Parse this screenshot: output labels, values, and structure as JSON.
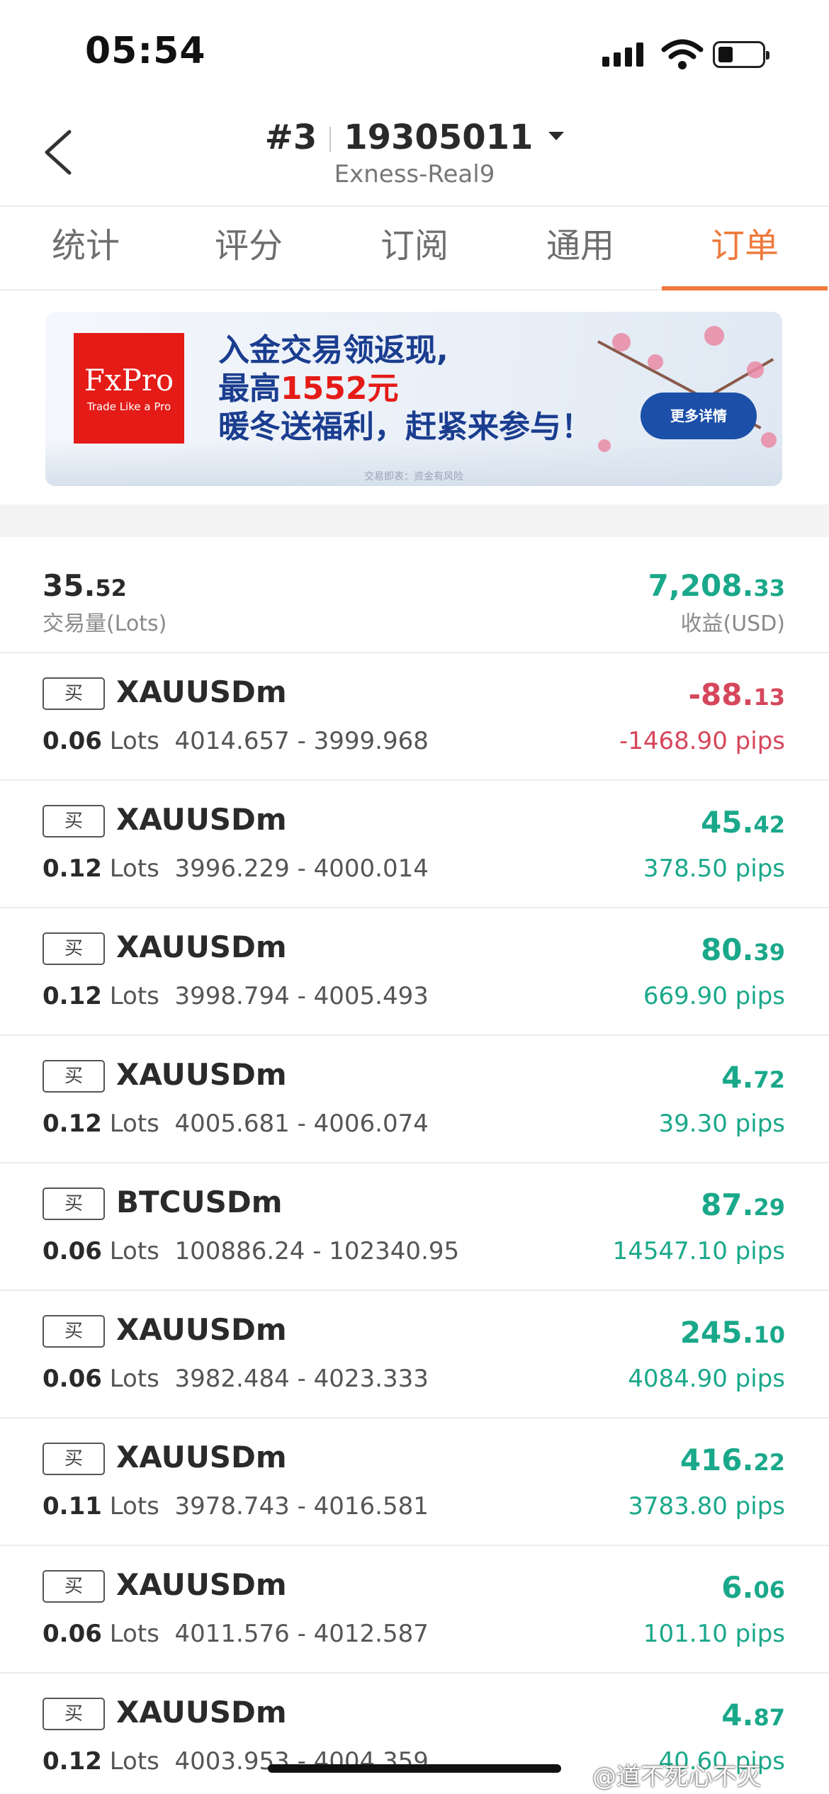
{
  "status_bar": {
    "time": "05:54"
  },
  "header": {
    "account_index": "#3",
    "account_number": "19305011",
    "server": "Exness-Real9"
  },
  "tabs": [
    {
      "label": "统计"
    },
    {
      "label": "评分"
    },
    {
      "label": "订阅"
    },
    {
      "label": "通用"
    },
    {
      "label": "订单",
      "active": true
    }
  ],
  "banner": {
    "logo_title": "FxPro",
    "logo_tagline": "Trade Like a Pro",
    "line1": "入金交易领返现,",
    "line2_prefix": "最高",
    "line2_highlight": "1552元",
    "line3": "暖冬送福利，赶紧来参与！",
    "button": "更多详情",
    "disclaimer": "交易即表：资金有风险"
  },
  "summary": {
    "volume_int": "35.",
    "volume_dec": "52",
    "volume_label": "交易量(Lots)",
    "profit_int": "7,208.",
    "profit_dec": "33",
    "profit_label": "收益(USD)"
  },
  "orders": [
    {
      "side": "买",
      "symbol": "XAUUSDm",
      "lots": "0.06",
      "lots_unit": "Lots",
      "prices": "4014.657 - 3999.968",
      "profit_int": "-88.",
      "profit_dec": "13",
      "pips": "-1468.90 pips",
      "positive": false
    },
    {
      "side": "买",
      "symbol": "XAUUSDm",
      "lots": "0.12",
      "lots_unit": "Lots",
      "prices": "3996.229 - 4000.014",
      "profit_int": "45.",
      "profit_dec": "42",
      "pips": "378.50 pips",
      "positive": true
    },
    {
      "side": "买",
      "symbol": "XAUUSDm",
      "lots": "0.12",
      "lots_unit": "Lots",
      "prices": "3998.794 - 4005.493",
      "profit_int": "80.",
      "profit_dec": "39",
      "pips": "669.90 pips",
      "positive": true
    },
    {
      "side": "买",
      "symbol": "XAUUSDm",
      "lots": "0.12",
      "lots_unit": "Lots",
      "prices": "4005.681 - 4006.074",
      "profit_int": "4.",
      "profit_dec": "72",
      "pips": "39.30 pips",
      "positive": true
    },
    {
      "side": "买",
      "symbol": "BTCUSDm",
      "lots": "0.06",
      "lots_unit": "Lots",
      "prices": "100886.24 - 102340.95",
      "profit_int": "87.",
      "profit_dec": "29",
      "pips": "14547.10 pips",
      "positive": true
    },
    {
      "side": "买",
      "symbol": "XAUUSDm",
      "lots": "0.06",
      "lots_unit": "Lots",
      "prices": "3982.484 - 4023.333",
      "profit_int": "245.",
      "profit_dec": "10",
      "pips": "4084.90 pips",
      "positive": true
    },
    {
      "side": "买",
      "symbol": "XAUUSDm",
      "lots": "0.11",
      "lots_unit": "Lots",
      "prices": "3978.743 - 4016.581",
      "profit_int": "416.",
      "profit_dec": "22",
      "pips": "3783.80 pips",
      "positive": true
    },
    {
      "side": "买",
      "symbol": "XAUUSDm",
      "lots": "0.06",
      "lots_unit": "Lots",
      "prices": "4011.576 - 4012.587",
      "profit_int": "6.",
      "profit_dec": "06",
      "pips": "101.10 pips",
      "positive": true
    },
    {
      "side": "买",
      "symbol": "XAUUSDm",
      "lots": "0.12",
      "lots_unit": "Lots",
      "prices": "4003.953 - 4004.359",
      "profit_int": "4.",
      "profit_dec": "87",
      "pips": "40.60 pips",
      "positive": true
    }
  ],
  "watermark": "@道不死心不灭",
  "colors": {
    "accent": "#ee7a3c",
    "positive": "#1aa88a",
    "negative": "#d6475c"
  }
}
